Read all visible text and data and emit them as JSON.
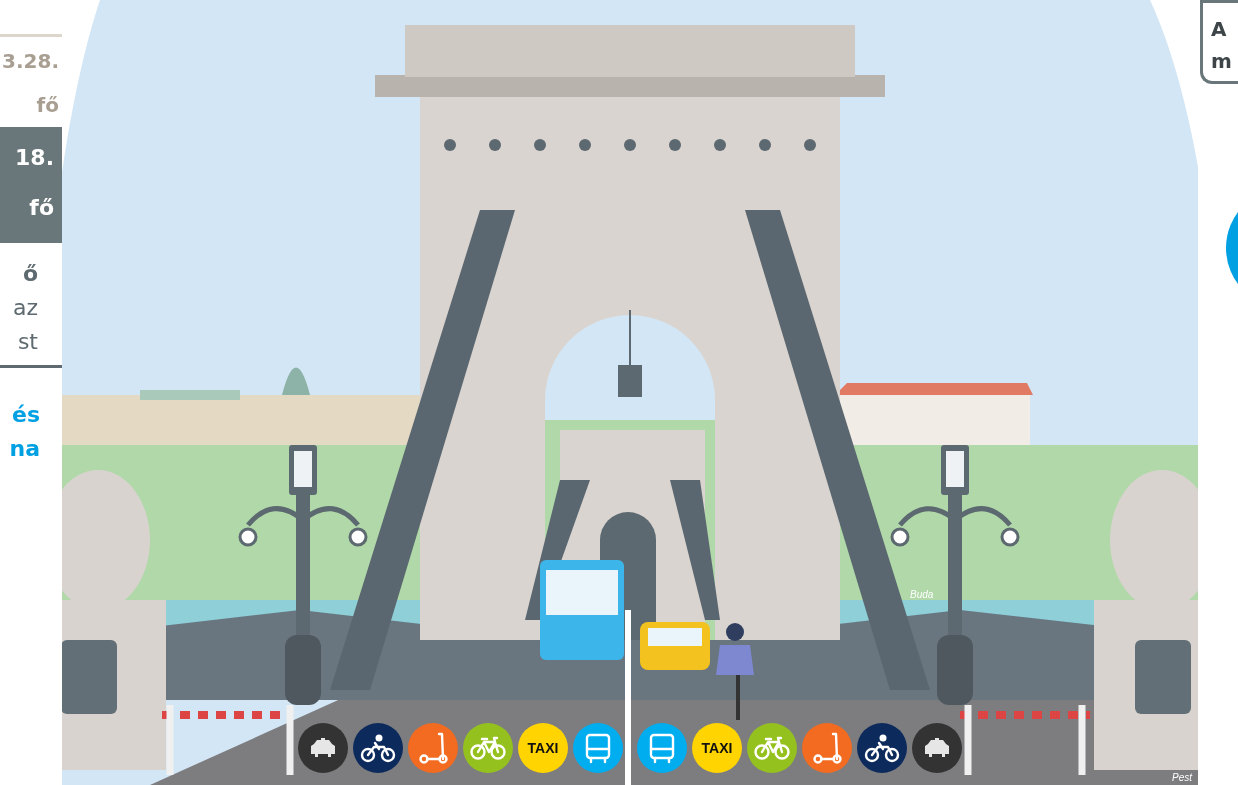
{
  "left_panel": {
    "date_1": "3.28.",
    "count_1": "fő",
    "highlight": {
      "date": "18.",
      "count": "fő"
    },
    "lines": [
      "ő",
      "az",
      "st"
    ],
    "link_lines": [
      "és",
      "na"
    ]
  },
  "right_panel": {
    "lines": [
      "A",
      "m"
    ]
  },
  "scene": {
    "far_bank": "Buda",
    "near_bank": "Pest",
    "lane_icons": [
      {
        "kind": "car",
        "color": "#333333"
      },
      {
        "kind": "motorbike",
        "color": "#0d2a5c"
      },
      {
        "kind": "scooter",
        "color": "#f26b21"
      },
      {
        "kind": "bicycle",
        "color": "#95c11f"
      },
      {
        "kind": "taxi",
        "color": "#ffd400",
        "label": "TAXI"
      },
      {
        "kind": "bus",
        "color": "#00adef"
      },
      {
        "kind": "bus",
        "color": "#00adef"
      },
      {
        "kind": "taxi",
        "color": "#ffd400",
        "label": "TAXI"
      },
      {
        "kind": "bicycle",
        "color": "#95c11f"
      },
      {
        "kind": "scooter",
        "color": "#f26b21"
      },
      {
        "kind": "motorbike",
        "color": "#0d2a5c"
      },
      {
        "kind": "car",
        "color": "#333333"
      }
    ]
  }
}
